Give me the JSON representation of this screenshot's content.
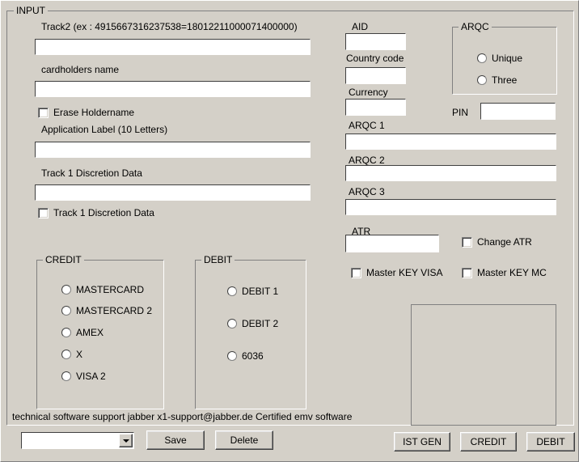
{
  "window": {
    "background_color": "#d4d0c8"
  },
  "input_group": {
    "title": "INPUT",
    "track2_label": "Track2 (ex : 4915667316237538=18012211000071400000)",
    "track2_value": "",
    "cardholders_label": "cardholders name",
    "cardholders_value": "",
    "erase_holdername_label": "Erase Holdername",
    "application_label_label": "Application Label (10 Letters)",
    "application_label_value": "",
    "track1_discretion_label": "Track 1 Discretion Data",
    "track1_discretion_value": "",
    "track1_discretion_checkbox_label": "Track 1 Discretion Data",
    "support_text": "technical software support jabber x1-support@jabber.de Certified emv software"
  },
  "right_fields": {
    "aid_label": "AID",
    "aid_value": "",
    "country_code_label": "Country code",
    "country_code_value": "",
    "currency_label": "Currency",
    "currency_value": "",
    "arqc1_label": "ARQC 1",
    "arqc1_value": "",
    "arqc2_label": "ARQC 2",
    "arqc2_value": "",
    "arqc3_label": "ARQC 3",
    "arqc3_value": "",
    "atr_label": "ATR",
    "atr_value": "",
    "change_atr_label": "Change ATR",
    "master_key_visa_label": "Master KEY VISA",
    "master_key_mc_label": "Master KEY MC",
    "pin_label": "PIN",
    "pin_value": ""
  },
  "arqc_group": {
    "title": "ARQC",
    "options": [
      {
        "label": "Unique",
        "selected": false
      },
      {
        "label": "Three",
        "selected": false
      }
    ]
  },
  "credit_group": {
    "title": "CREDIT",
    "options": [
      {
        "label": "MASTERCARD",
        "selected": false
      },
      {
        "label": "MASTERCARD 2",
        "selected": false
      },
      {
        "label": "AMEX",
        "selected": false
      },
      {
        "label": "X",
        "selected": false
      },
      {
        "label": "VISA 2",
        "selected": false
      }
    ]
  },
  "debit_group": {
    "title": "DEBIT",
    "options": [
      {
        "label": "DEBIT 1",
        "selected": false
      },
      {
        "label": "DEBIT 2",
        "selected": false
      },
      {
        "label": "6036",
        "selected": false
      }
    ]
  },
  "bottom_bar": {
    "profile_select_value": "",
    "profile_select_arrow": "chevron-down-icon",
    "save_label": "Save",
    "delete_label": "Delete",
    "ist_gen_label": "IST GEN",
    "credit_label": "CREDIT",
    "debit_label": "DEBIT"
  }
}
